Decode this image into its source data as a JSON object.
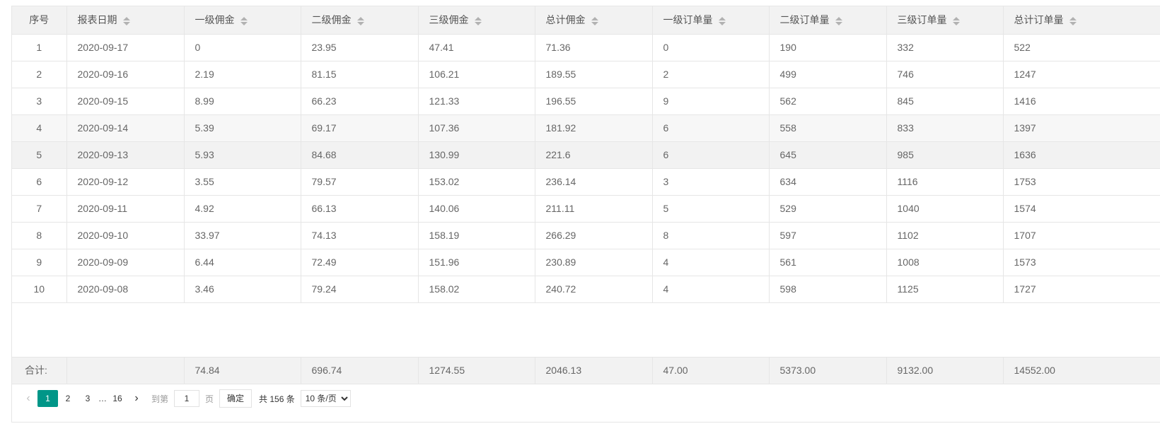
{
  "table": {
    "columns": [
      "序号",
      "报表日期",
      "一级佣金",
      "二级佣金",
      "三级佣金",
      "总计佣金",
      "一级订单量",
      "二级订单量",
      "三级订单量",
      "总计订单量"
    ],
    "rows": [
      [
        "1",
        "2020-09-17",
        "0",
        "23.95",
        "47.41",
        "71.36",
        "0",
        "190",
        "332",
        "522"
      ],
      [
        "2",
        "2020-09-16",
        "2.19",
        "81.15",
        "106.21",
        "189.55",
        "2",
        "499",
        "746",
        "1247"
      ],
      [
        "3",
        "2020-09-15",
        "8.99",
        "66.23",
        "121.33",
        "196.55",
        "9",
        "562",
        "845",
        "1416"
      ],
      [
        "4",
        "2020-09-14",
        "5.39",
        "69.17",
        "107.36",
        "181.92",
        "6",
        "558",
        "833",
        "1397"
      ],
      [
        "5",
        "2020-09-13",
        "5.93",
        "84.68",
        "130.99",
        "221.6",
        "6",
        "645",
        "985",
        "1636"
      ],
      [
        "6",
        "2020-09-12",
        "3.55",
        "79.57",
        "153.02",
        "236.14",
        "3",
        "634",
        "1116",
        "1753"
      ],
      [
        "7",
        "2020-09-11",
        "4.92",
        "66.13",
        "140.06",
        "211.11",
        "5",
        "529",
        "1040",
        "1574"
      ],
      [
        "8",
        "2020-09-10",
        "33.97",
        "74.13",
        "158.19",
        "266.29",
        "8",
        "597",
        "1102",
        "1707"
      ],
      [
        "9",
        "2020-09-09",
        "6.44",
        "72.49",
        "151.96",
        "230.89",
        "4",
        "561",
        "1008",
        "1573"
      ],
      [
        "10",
        "2020-09-08",
        "3.46",
        "79.24",
        "158.02",
        "240.72",
        "4",
        "598",
        "1125",
        "1727"
      ]
    ],
    "totals": {
      "label": "合计:",
      "values": [
        "",
        "74.84",
        "696.74",
        "1274.55",
        "2046.13",
        "47.00",
        "5373.00",
        "9132.00",
        "14552.00"
      ]
    }
  },
  "pagination": {
    "prev_icon": "chevron-left-icon",
    "next_icon": "chevron-right-icon",
    "pages": [
      "1",
      "2",
      "3"
    ],
    "ellipsis": "…",
    "last_page": "16",
    "current_page": "1",
    "goto_label": "到第",
    "goto_value": "1",
    "page_unit": "页",
    "confirm_label": "确定",
    "total_text": "共 156 条",
    "page_size": "10 条/页",
    "accent_color": "#009688"
  }
}
